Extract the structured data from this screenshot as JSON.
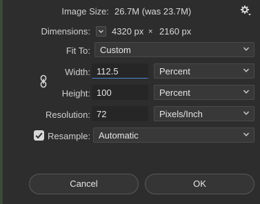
{
  "image_size": {
    "label": "Image Size:",
    "value": "26.7M (was 23.7M)"
  },
  "dimensions": {
    "label": "Dimensions:",
    "width": "4320 px",
    "times": "×",
    "height": "2160 px"
  },
  "fit_to": {
    "label": "Fit To:",
    "value": "Custom"
  },
  "width": {
    "label": "Width:",
    "value": "112.5",
    "unit": "Percent"
  },
  "height": {
    "label": "Height:",
    "value": "100",
    "unit": "Percent"
  },
  "resolution": {
    "label": "Resolution:",
    "value": "72",
    "unit": "Pixels/Inch"
  },
  "resample": {
    "label": "Resample:",
    "value": "Automatic",
    "checked": true
  },
  "buttons": {
    "cancel": "Cancel",
    "ok": "OK"
  },
  "icons": {
    "settings": "gear-icon",
    "link": "chain-link-icon",
    "dims_toggle": "chevron-down-icon"
  },
  "colors": {
    "focus": "#4a82d6",
    "background": "#2d2d2d"
  }
}
